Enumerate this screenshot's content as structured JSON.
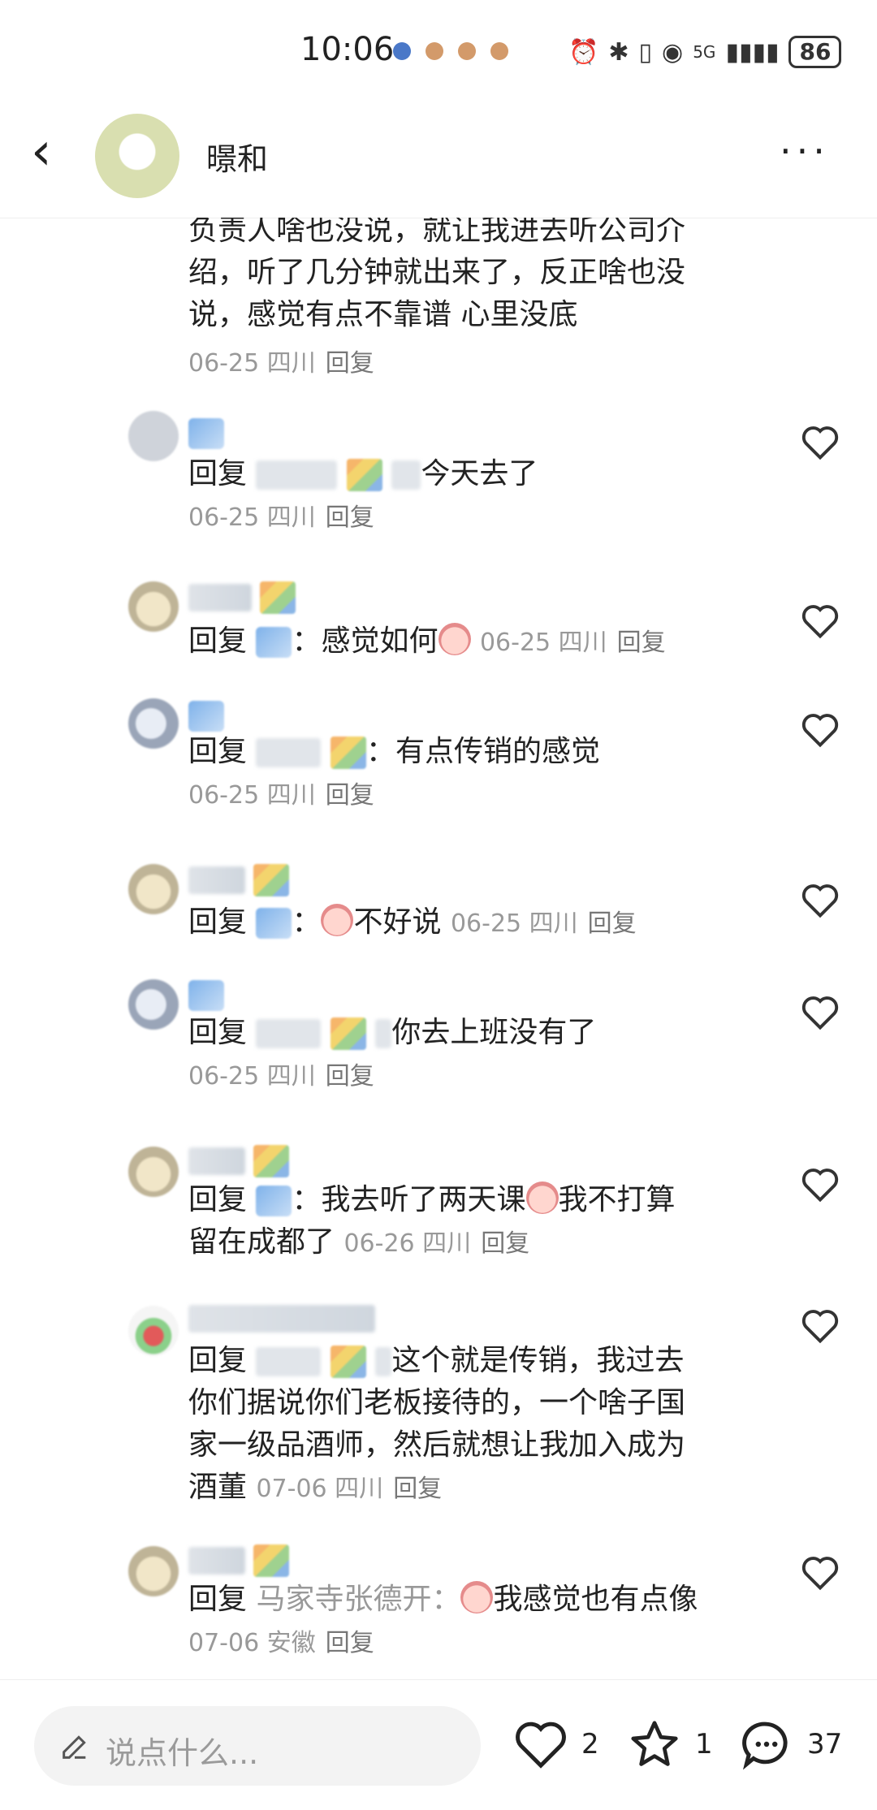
{
  "status": {
    "time": "10:06",
    "battery": "86",
    "network": "5G"
  },
  "header": {
    "name": "暻和"
  },
  "comments": [
    {
      "lines": [
        "负责人啥也没说，就让我进去听公司介",
        "绍，听了几分钟就出来了，反正啥也没",
        "说，感觉有点不靠谱 心里没底"
      ],
      "meta": "06-25 四川",
      "reply": "回复"
    },
    {
      "prefix": "回复",
      "text": "今天去了",
      "meta": "06-25 四川",
      "reply": "回复"
    },
    {
      "prefix": "回复",
      "text": "感觉如何",
      "meta": "06-25 四川",
      "reply": "回复"
    },
    {
      "prefix": "回复",
      "text": "有点传销的感觉",
      "meta": "06-25 四川",
      "reply": "回复"
    },
    {
      "prefix": "回复",
      "text": "不好说",
      "meta": "06-25 四川",
      "reply": "回复"
    },
    {
      "prefix": "回复",
      "text": "你去上班没有了",
      "meta": "06-25 四川",
      "reply": "回复"
    },
    {
      "prefix": "回复",
      "text": "我去听了两天课",
      "text2": "我不打算",
      "line2": "留在成都了",
      "meta": "06-26 四川",
      "reply": "回复"
    },
    {
      "prefix": "回复",
      "text": "这个就是传销，我过去",
      "lines": [
        "你们据说你们老板接待的，一个啥子国",
        "家一级品酒师，然后就想让我加入成为"
      ],
      "last": "酒董",
      "meta": "07-06 四川",
      "reply": "回复"
    },
    {
      "prefix": "回复",
      "target": "马家寺张德开：",
      "text": "我感觉也有点像",
      "meta": "07-06 安徽",
      "reply": "回复"
    }
  ],
  "bottom": {
    "placeholder": "说点什么...",
    "likes": "2",
    "favorites": "1",
    "comments": "37"
  }
}
